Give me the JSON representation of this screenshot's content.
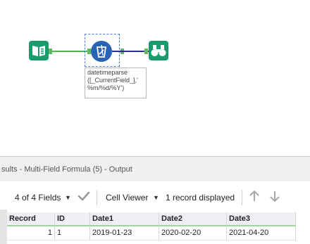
{
  "canvas": {
    "tools": [
      {
        "name": "input-data-icon",
        "kind": "Input Data"
      },
      {
        "name": "formula-icon",
        "kind": "Multi-Field Formula"
      },
      {
        "name": "browse-icon",
        "kind": "Browse"
      }
    ],
    "annotation": "datetimeparse\n([_CurrentField_],'\n%m/%d/%Y')"
  },
  "results": {
    "title": "sults - Multi-Field Formula (5) - Output",
    "fields_label": "4 of 4 Fields",
    "viewer_label": "Cell Viewer",
    "record_count": "1 record displayed"
  },
  "grid": {
    "columns": [
      "Record",
      "ID",
      "Date1",
      "Date2",
      "Date3"
    ],
    "rows": [
      [
        "1",
        "1",
        "2019-01-23",
        "2020-02-20",
        "2021-04-20"
      ]
    ]
  },
  "colors": {
    "tool_green": "#1a9b6c",
    "formula_blue": "#2a62b4",
    "connection_green": "#58b058",
    "connection_navy": "#2d2d8c"
  }
}
